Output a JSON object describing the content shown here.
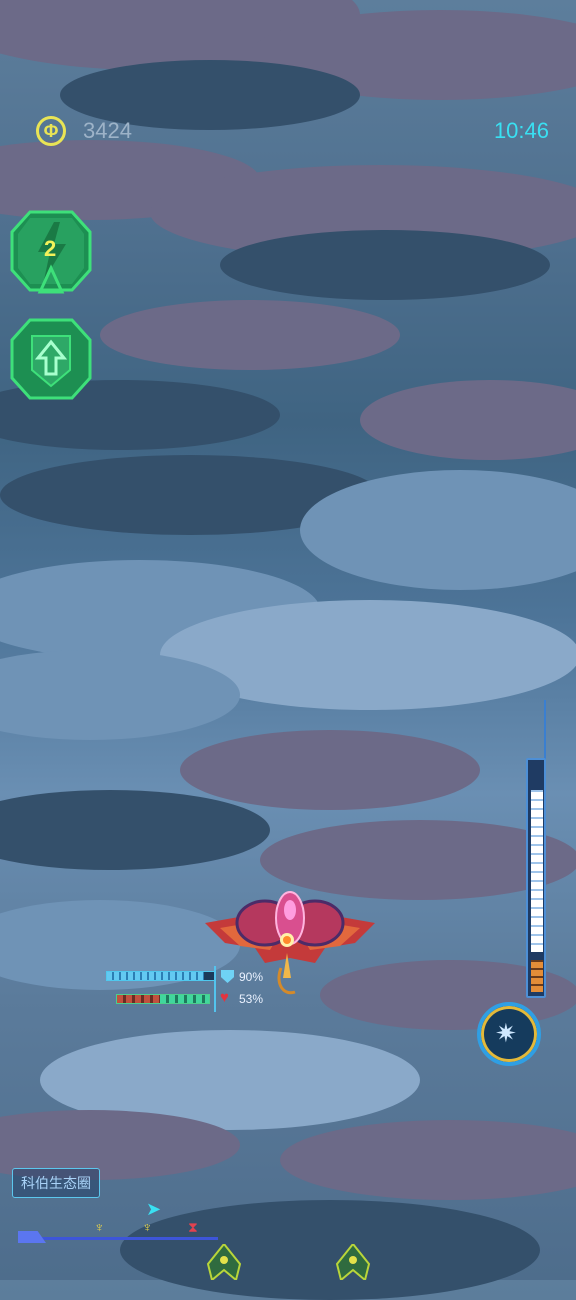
{
  "hud": {
    "coins": "3424",
    "time": "10:46",
    "coin_icon": "coin-icon"
  },
  "powerups": {
    "bomb_count": "2",
    "bomb_icon": "lightning-bomb-icon",
    "upgrade_icon": "up-arrow-shield-icon"
  },
  "player": {
    "shield_percent_label": "90%",
    "health_percent_label": "53%",
    "shield_level": 0.9,
    "health_level": 0.53
  },
  "power_gauge": {
    "level": 0.85
  },
  "special": {
    "icon": "burst-icon"
  },
  "chat": {
    "text": "科伯生态圈"
  },
  "colors": {
    "accent_cyan": "#39e0f2",
    "coin_yellow": "#e9e455",
    "powerup_green": "#3ee07a",
    "shield_blue": "#63c9f2",
    "health_red": "#e3343f"
  }
}
